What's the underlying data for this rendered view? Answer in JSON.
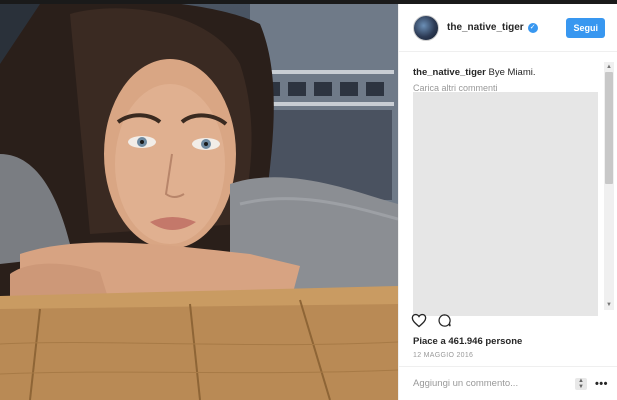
{
  "post": {
    "username": "the_native_tiger",
    "follow_label": "Segui",
    "caption_user": "the_native_tiger",
    "caption_text": "Bye Miami.",
    "load_more": "Carica altri commenti",
    "likes": "Piace a 461.946 persone",
    "date": "12 MAGGIO 2016",
    "comment_placeholder": "Aggiungi un commento...",
    "more_label": "•••"
  },
  "icons": {
    "verified": "verified-badge-icon",
    "like": "heart-icon",
    "comment": "comment-bubble-icon",
    "more": "more-options-icon"
  },
  "colors": {
    "accent": "#3897f0",
    "text": "#262626",
    "muted": "#999999"
  }
}
